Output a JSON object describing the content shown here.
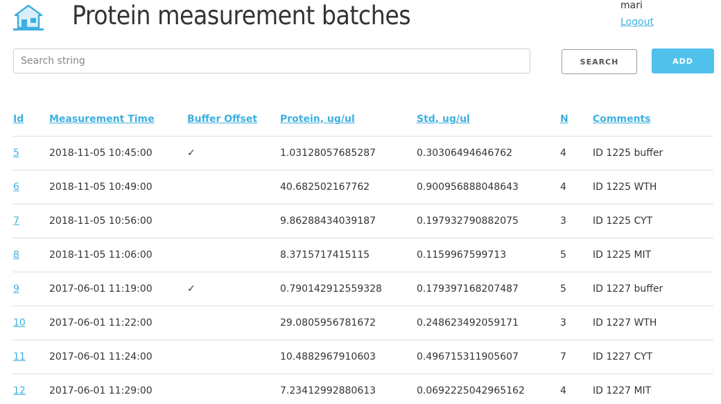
{
  "header": {
    "title": "Protein measurement batches",
    "user": "mari",
    "logout_label": "Logout",
    "logo_icon": "house-icon",
    "accent_color": "#3eb0e0"
  },
  "search": {
    "placeholder": "Search string",
    "value": "",
    "search_label": "SEARCH",
    "add_label": "ADD"
  },
  "table": {
    "columns": [
      "Id",
      "Measurement Time",
      "Buffer Offset",
      "Protein, ug/ul",
      "Std, ug/ul",
      "N",
      "Comments"
    ],
    "rows": [
      {
        "id": "5",
        "time": "2018-11-05 10:45:00",
        "buffer": "✓",
        "protein": "1.03128057685287",
        "std": "0.30306494646762",
        "n": "4",
        "comments": "ID 1225 buffer"
      },
      {
        "id": "6",
        "time": "2018-11-05 10:49:00",
        "buffer": "",
        "protein": "40.682502167762",
        "std": "0.900956888048643",
        "n": "4",
        "comments": "ID 1225 WTH"
      },
      {
        "id": "7",
        "time": "2018-11-05 10:56:00",
        "buffer": "",
        "protein": "9.86288434039187",
        "std": "0.197932790882075",
        "n": "3",
        "comments": "ID 1225 CYT"
      },
      {
        "id": "8",
        "time": "2018-11-05 11:06:00",
        "buffer": "",
        "protein": "8.3715717415115",
        "std": "0.1159967599713",
        "n": "5",
        "comments": "ID 1225 MIT"
      },
      {
        "id": "9",
        "time": "2017-06-01 11:19:00",
        "buffer": "✓",
        "protein": "0.790142912559328",
        "std": "0.179397168207487",
        "n": "5",
        "comments": "ID 1227 buffer"
      },
      {
        "id": "10",
        "time": "2017-06-01 11:22:00",
        "buffer": "",
        "protein": "29.0805956781672",
        "std": "0.248623492059171",
        "n": "3",
        "comments": "ID 1227 WTH"
      },
      {
        "id": "11",
        "time": "2017-06-01 11:24:00",
        "buffer": "",
        "protein": "10.4882967910603",
        "std": "0.496715311905607",
        "n": "7",
        "comments": "ID 1227 CYT"
      },
      {
        "id": "12",
        "time": "2017-06-01 11:29:00",
        "buffer": "",
        "protein": "7.23412992880613",
        "std": "0.0692225042965162",
        "n": "4",
        "comments": "ID 1227 MIT"
      }
    ]
  }
}
